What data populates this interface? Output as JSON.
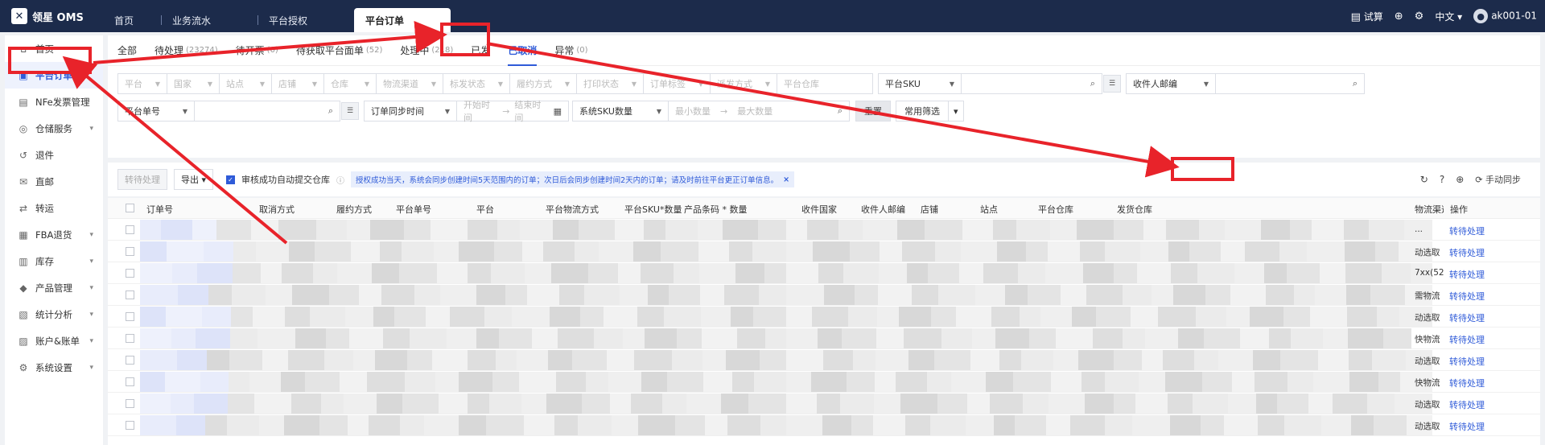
{
  "brand": {
    "name": "领星 OMS",
    "logo": "logo-icon"
  },
  "top_tabs": [
    {
      "label": "首页"
    },
    {
      "label": "业务流水"
    },
    {
      "label": "平台授权"
    },
    {
      "label": "平台订单",
      "active": true
    }
  ],
  "top_right": {
    "trial": "试算",
    "lang": "中文",
    "user": "ak001-01"
  },
  "sidebar": {
    "items": [
      {
        "label": "首页",
        "icon": "home-icon"
      },
      {
        "label": "平台订单",
        "icon": "order-icon",
        "active": true
      },
      {
        "label": "NFe发票管理",
        "icon": "invoice-icon"
      },
      {
        "label": "仓储服务",
        "icon": "warehouse-icon",
        "expandable": true
      },
      {
        "label": "退件",
        "icon": "return-icon"
      },
      {
        "label": "直邮",
        "icon": "mail-icon"
      },
      {
        "label": "转运",
        "icon": "transfer-icon"
      },
      {
        "label": "FBA退货",
        "icon": "fba-icon",
        "expandable": true
      },
      {
        "label": "库存",
        "icon": "stock-icon",
        "expandable": true
      },
      {
        "label": "产品管理",
        "icon": "product-icon",
        "expandable": true
      },
      {
        "label": "统计分析",
        "icon": "stats-icon",
        "expandable": true
      },
      {
        "label": "账户&账单",
        "icon": "account-icon",
        "expandable": true
      },
      {
        "label": "系统设置",
        "icon": "settings-icon",
        "expandable": true
      }
    ]
  },
  "status_tabs": [
    {
      "label": "全部",
      "count": ""
    },
    {
      "label": "待处理",
      "count": "(23274)"
    },
    {
      "label": "待开票",
      "count": "(0)"
    },
    {
      "label": "待获取平台面单",
      "count": "(52)"
    },
    {
      "label": "处理中",
      "count": "(218)"
    },
    {
      "label": "已发",
      "count": ""
    },
    {
      "label": "已取消",
      "count": "",
      "active": true
    },
    {
      "label": "异常",
      "count": "(0)"
    }
  ],
  "filters": {
    "row1": [
      "平台",
      "国家",
      "站点",
      "店铺",
      "仓库",
      "物流渠道",
      "标发状态",
      "履约方式",
      "打印状态",
      "订单标签",
      "派发方式"
    ],
    "row1_input": "平台仓库",
    "sku_select": "平台SKU",
    "postcode_select": "收件人邮编",
    "row2_select": "平台单号",
    "time_select": "订单同步时间",
    "start_time": "开始时间",
    "arrow": "→",
    "end_time": "结束时间",
    "sku_qty_select": "系统SKU数量",
    "min_qty": "最小数量",
    "max_qty": "最大数量",
    "reset": "重置",
    "common_filter": "常用筛选"
  },
  "toolbar": {
    "to_process": "转待处理",
    "export": "导出",
    "auto_submit_label": "审核成功自动提交仓库",
    "tip": "授权成功当天，系统会同步创建时间5天范围内的订单；次日后会同步创建时间2天内的订单；请及时前往平台更正订单信息。",
    "manual_sync": "手动同步"
  },
  "table": {
    "headers": [
      "订单号",
      "取消方式",
      "履约方式",
      "平台单号",
      "平台",
      "平台物流方式",
      "平台SKU*数量",
      "产品条码 * 数量",
      "收件国家",
      "收件人邮编",
      "店铺",
      "站点",
      "平台仓库",
      "发货仓库",
      "物流渠道",
      "操作"
    ],
    "rows": [
      {
        "channel": "...",
        "action": "转待处理"
      },
      {
        "channel": "动选取",
        "action": "转待处理"
      },
      {
        "channel": "7xx(52",
        "action": "转待处理"
      },
      {
        "channel": "需物流",
        "action": "转待处理"
      },
      {
        "channel": "动选取",
        "action": "转待处理"
      },
      {
        "channel": "快物流",
        "action": "转待处理"
      },
      {
        "channel": "动选取",
        "action": "转待处理"
      },
      {
        "channel": "快物流",
        "action": "转待处理"
      },
      {
        "channel": "动选取",
        "action": "转待处理"
      },
      {
        "channel": "动选取",
        "action": "转待处理"
      }
    ]
  },
  "colors": {
    "accent": "#2f5bd8",
    "topbar": "#1c2b4b",
    "annotation": "#e8232a"
  }
}
